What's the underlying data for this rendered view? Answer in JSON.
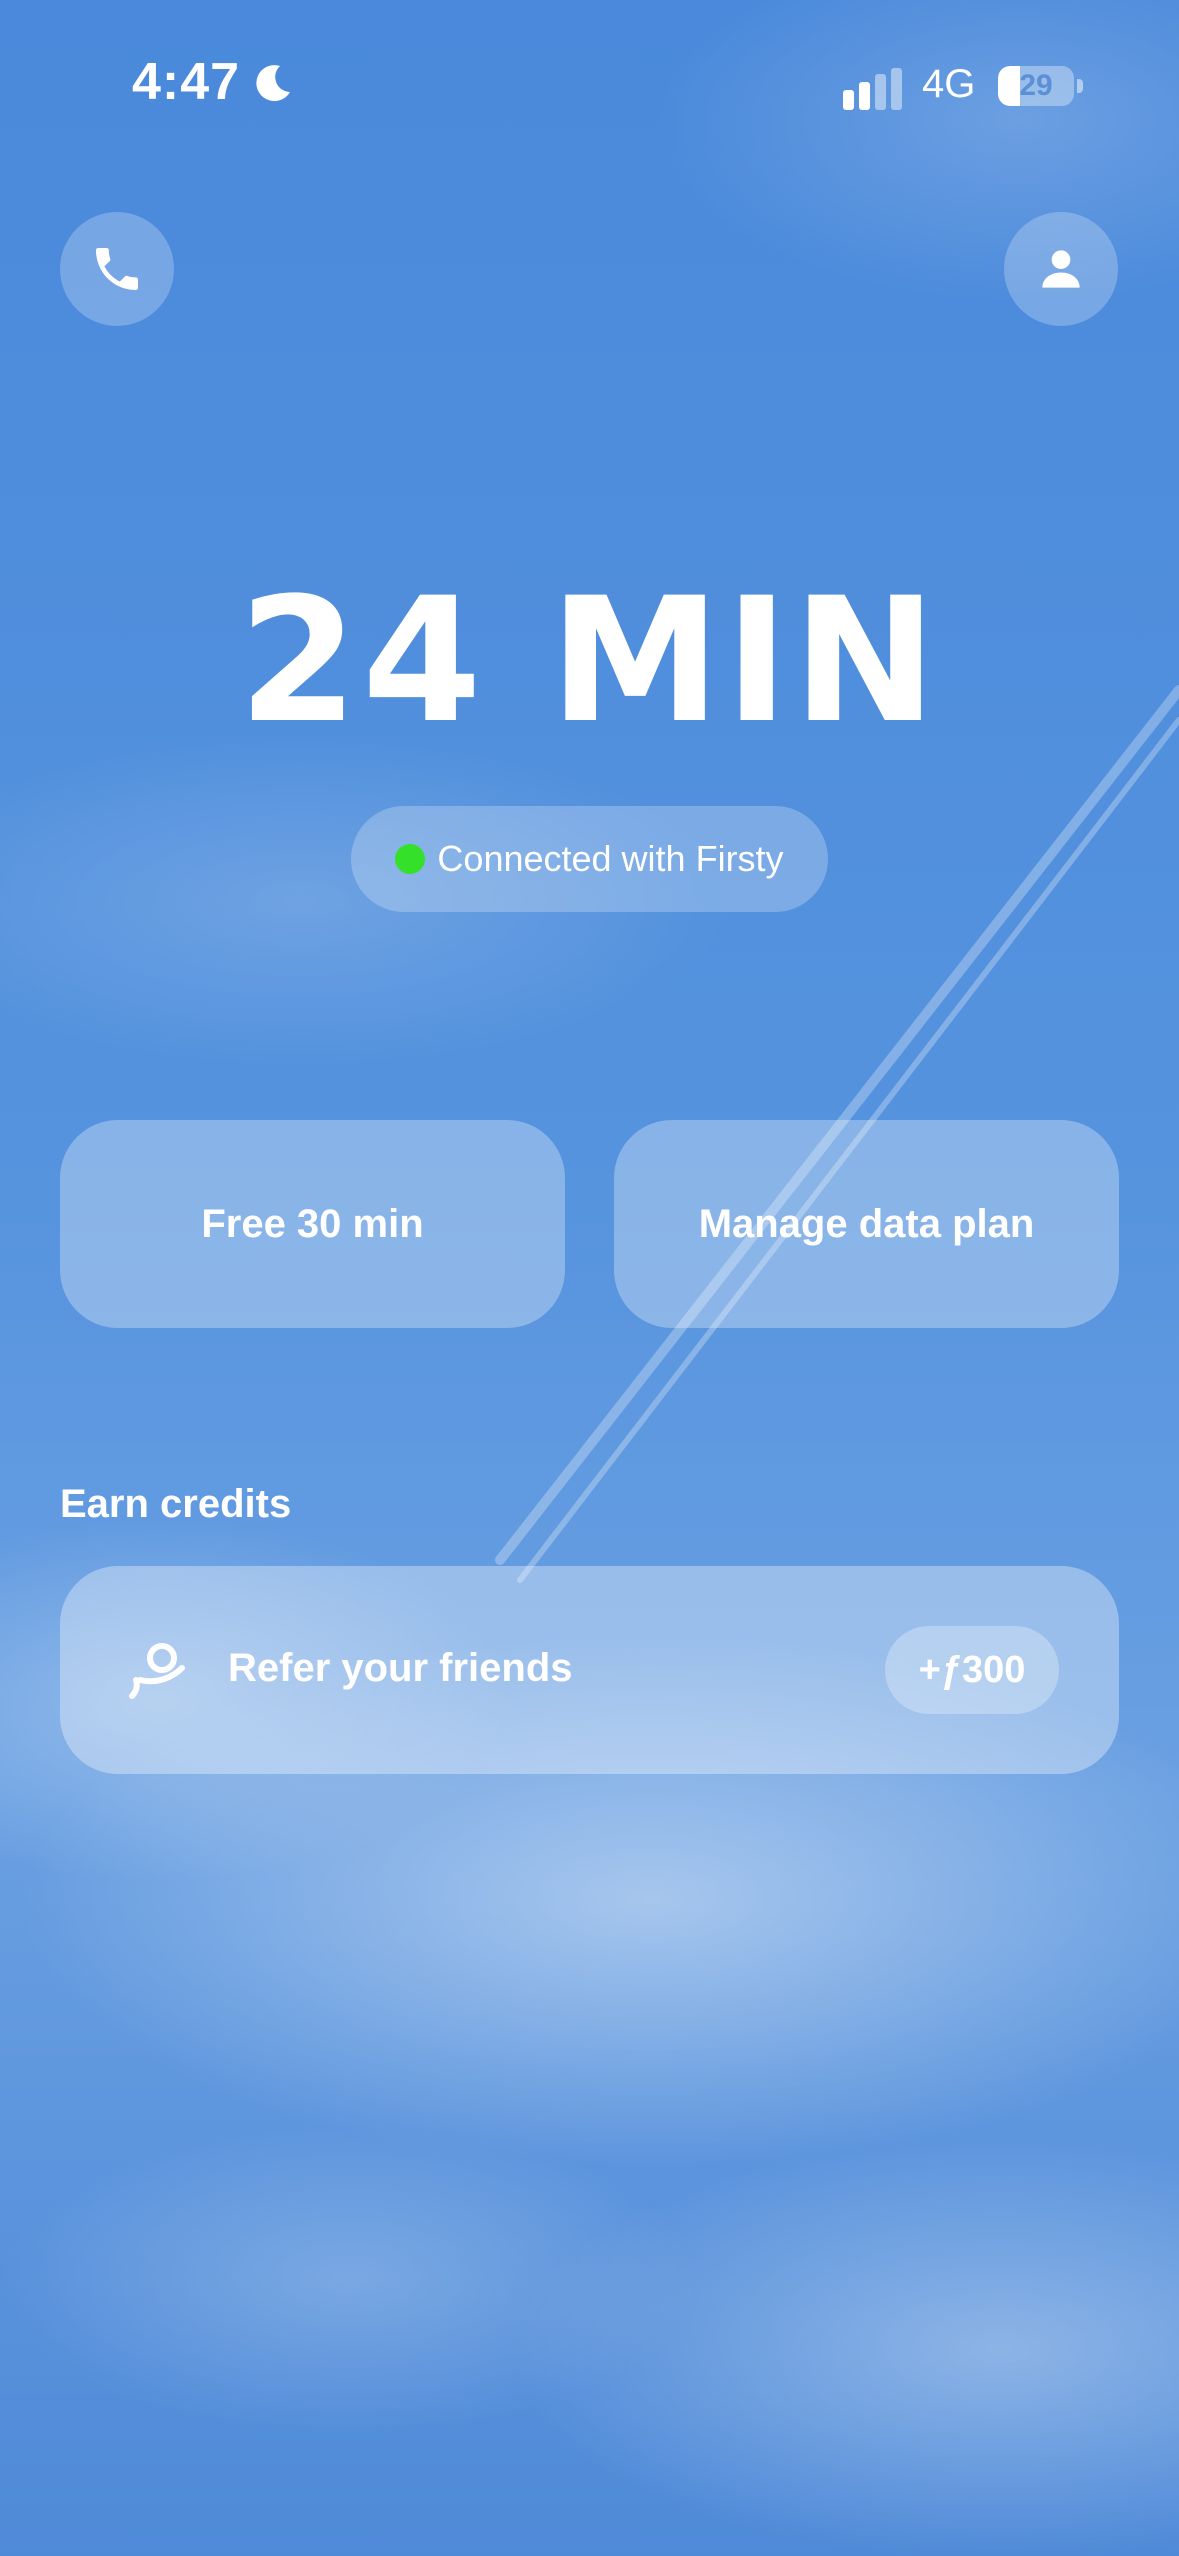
{
  "status_bar": {
    "time": "4:47",
    "network": "4G",
    "battery_level": "29",
    "battery_fraction": 0.29,
    "focus_icon": "moon-icon",
    "signal_icon": "cellular-signal-icon"
  },
  "header": {
    "left_icon": "phone-icon",
    "right_icon": "person-icon"
  },
  "timer": {
    "value": "24 MIN"
  },
  "connection": {
    "status_text": "Connected with Firsty",
    "status_color": "#35e02a"
  },
  "actions": {
    "free_label": "Free 30 min",
    "plan_label": "Manage data plan"
  },
  "earn": {
    "section_title": "Earn credits",
    "refer_label": "Refer your friends",
    "refer_credit": "+ƒ300",
    "refer_icon": "refer-person-icon"
  },
  "colors": {
    "background": "#4f8ddb",
    "accent_green": "#35e02a"
  }
}
